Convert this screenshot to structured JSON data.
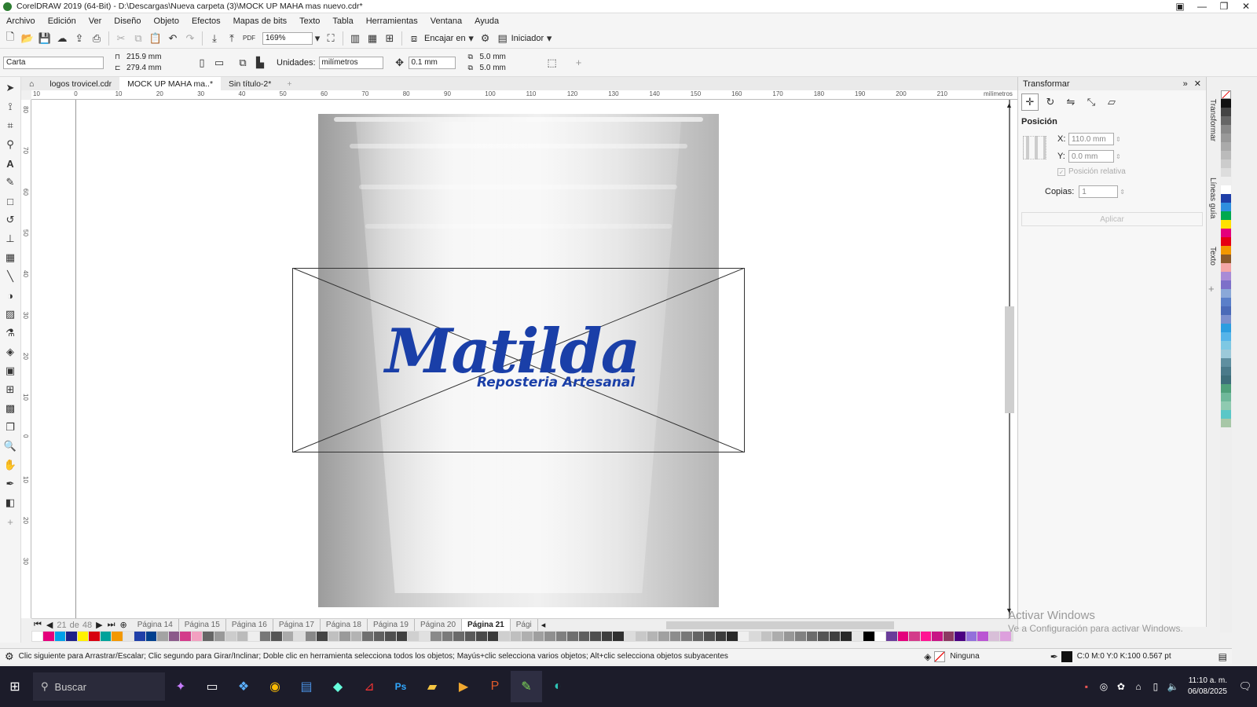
{
  "window": {
    "title": "CorelDRAW 2019 (64-Bit) - D:\\Descargas\\Nueva carpeta (3)\\MOCK UP MAHA mas nuevo.cdr*",
    "min": "—",
    "max": "❐",
    "close": "✕"
  },
  "menu": [
    "Archivo",
    "Edición",
    "Ver",
    "Diseño",
    "Objeto",
    "Efectos",
    "Mapas de bits",
    "Texto",
    "Tabla",
    "Herramientas",
    "Ventana",
    "Ayuda"
  ],
  "toolbar": {
    "zoom": "169%",
    "snap_label": "Encajar en",
    "launcher_label": "Iniciador"
  },
  "propbar": {
    "page_size": "Carta",
    "width": "215.9 mm",
    "height": "279.4 mm",
    "units_label": "Unidades:",
    "units": "milímetros",
    "nudge": "0.1 mm",
    "dup_x": "5.0 mm",
    "dup_y": "5.0 mm"
  },
  "tabs": [
    "logos trovicel.cdr",
    "MOCK UP MAHA ma..*",
    "Sin título-2*"
  ],
  "ruler": {
    "h_ticks": [
      "10",
      "0",
      "10",
      "20",
      "30",
      "40",
      "50",
      "60",
      "70",
      "80",
      "90",
      "100",
      "110",
      "120",
      "130",
      "140",
      "150",
      "160",
      "170",
      "180",
      "190",
      "200",
      "210"
    ],
    "unit": "milímetros",
    "v_ticks": [
      "80",
      "70",
      "60",
      "50",
      "40",
      "30",
      "20",
      "10",
      "0",
      "10",
      "20",
      "30"
    ]
  },
  "canvas": {
    "logo_main": "Matilda",
    "logo_sub": "Reposteria Artesanal"
  },
  "docker": {
    "title": "Transformar",
    "section": "Posición",
    "x_label": "X:",
    "x_value": "110.0 mm",
    "y_label": "Y:",
    "y_value": "0.0 mm",
    "relative_label": "Posición relativa",
    "copies_label": "Copias:",
    "copies_value": "1",
    "apply_label": "Aplicar"
  },
  "docker_tabs": [
    "Transformar",
    "Líneas guía",
    "Texto"
  ],
  "pagenav": {
    "current": "21",
    "of": "de",
    "total": "48",
    "pages": [
      "Página 14",
      "Página 15",
      "Página 16",
      "Página 17",
      "Página 18",
      "Página 19",
      "Página 20",
      "Página 21",
      "Pági"
    ],
    "active_index": 7
  },
  "status": {
    "hint": "Clic siguiente para Arrastrar/Escalar; Clic segundo para Girar/Inclinar; Doble clic en herramienta selecciona todos los objetos; Mayús+clic selecciona varios objetos; Alt+clic selecciona objetos subyacentes",
    "fill": "Ninguna",
    "outline": "C:0 M:0 Y:0 K:100  0.567 pt"
  },
  "watermark": {
    "line1": "Activar Windows",
    "line2": "Ve a Configuración para activar Windows."
  },
  "taskbar": {
    "search": "Buscar",
    "time": "11:10 a. m.",
    "date": "06/08/2025"
  },
  "colors": {
    "logo_blue": "#1a3fa8",
    "taskbar": "#1c1c2a"
  }
}
